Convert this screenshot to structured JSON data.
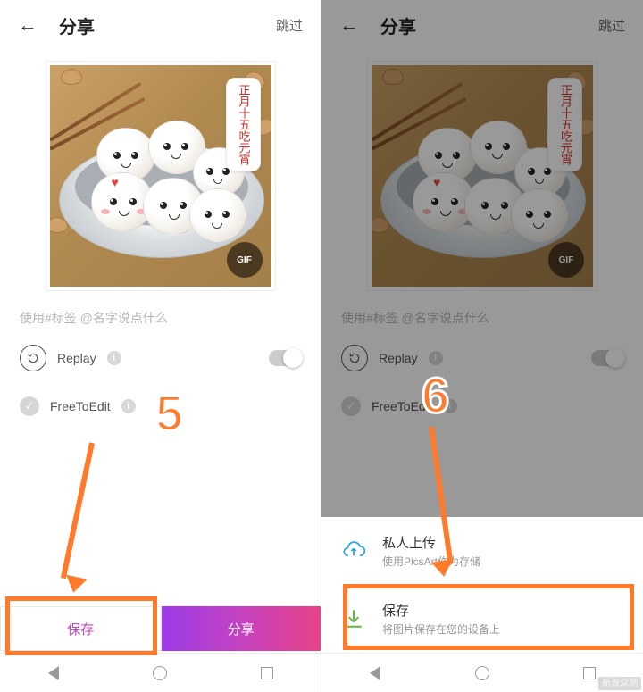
{
  "left": {
    "header": {
      "title": "分享",
      "skip": "跳过"
    },
    "bubble": {
      "line1": "正月十五",
      "line2": "吃元宵"
    },
    "gif_badge": "GIF",
    "placeholder": "使用#标签 @名字说点什么",
    "replay_label": "Replay",
    "free_to_edit": "FreeToEdit",
    "save_btn": "保存",
    "share_btn": "分享",
    "marker": "5"
  },
  "right": {
    "header": {
      "title": "分享",
      "skip": "跳过"
    },
    "bubble": {
      "line1": "正月十五",
      "line2": "吃元宵"
    },
    "gif_badge": "GIF",
    "placeholder": "使用#标签 @名字说点什么",
    "replay_label": "Replay",
    "free_to_edit": "FreeToEdit",
    "sheet": {
      "upload": {
        "title": "私人上传",
        "sub": "使用PicsArt作为存储"
      },
      "save": {
        "title": "保存",
        "sub": "将图片保存在您的设备上"
      }
    },
    "marker": "6"
  },
  "watermark": "新浪众测"
}
